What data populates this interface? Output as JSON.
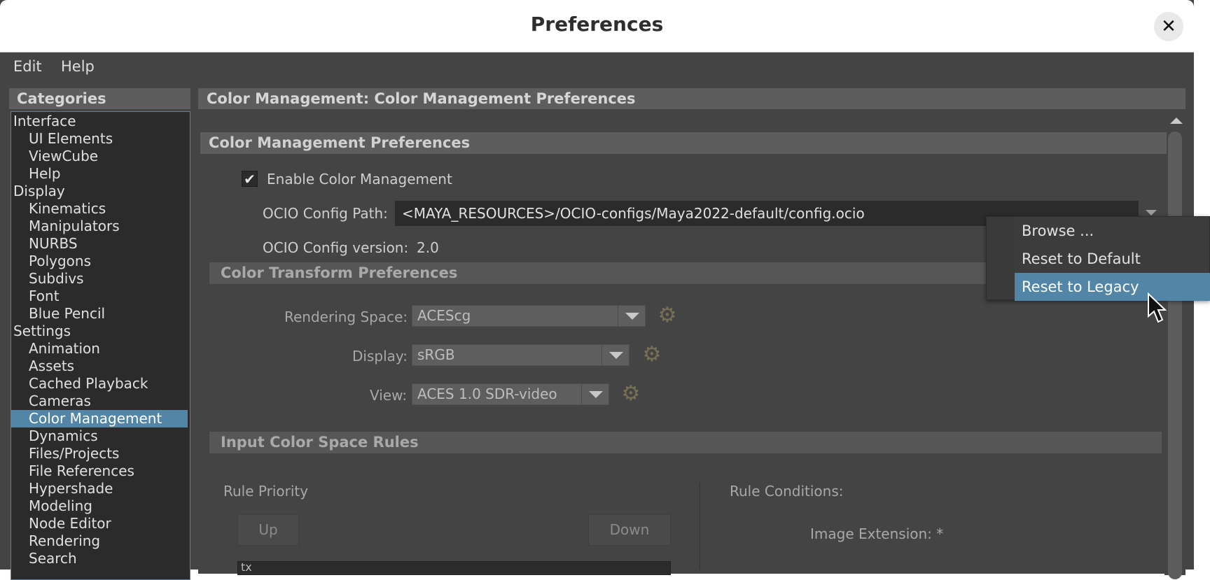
{
  "window": {
    "title": "Preferences",
    "close_glyph": "✕"
  },
  "menubar": {
    "items": [
      "Edit",
      "Help"
    ]
  },
  "categories": {
    "header": "Categories",
    "items": [
      {
        "label": "Interface",
        "indent": 0
      },
      {
        "label": "UI Elements",
        "indent": 1
      },
      {
        "label": "ViewCube",
        "indent": 1
      },
      {
        "label": "Help",
        "indent": 1
      },
      {
        "label": "Display",
        "indent": 0
      },
      {
        "label": "Kinematics",
        "indent": 1
      },
      {
        "label": "Manipulators",
        "indent": 1
      },
      {
        "label": "NURBS",
        "indent": 1
      },
      {
        "label": "Polygons",
        "indent": 1
      },
      {
        "label": "Subdivs",
        "indent": 1
      },
      {
        "label": "Font",
        "indent": 1
      },
      {
        "label": "Blue Pencil",
        "indent": 1
      },
      {
        "label": "Settings",
        "indent": 0
      },
      {
        "label": "Animation",
        "indent": 1
      },
      {
        "label": "Assets",
        "indent": 1
      },
      {
        "label": "Cached Playback",
        "indent": 1
      },
      {
        "label": "Cameras",
        "indent": 1
      },
      {
        "label": "Color Management",
        "indent": 1
      },
      {
        "label": "Dynamics",
        "indent": 1
      },
      {
        "label": "Files/Projects",
        "indent": 1
      },
      {
        "label": "File References",
        "indent": 1
      },
      {
        "label": "Hypershade",
        "indent": 1
      },
      {
        "label": "Modeling",
        "indent": 1
      },
      {
        "label": "Node Editor",
        "indent": 1
      },
      {
        "label": "Rendering",
        "indent": 1
      },
      {
        "label": "Search",
        "indent": 1
      }
    ],
    "selected": "Color Management"
  },
  "main": {
    "header": "Color Management: Color Management Preferences",
    "section_cm": "Color Management Preferences",
    "enable_label": "Enable Color Management",
    "enable_checked": true,
    "ocio_path_label": "OCIO Config Path:",
    "ocio_path_value": "<MAYA_RESOURCES>/OCIO-configs/Maya2022-default/config.ocio",
    "ocio_version_label": "OCIO Config version:",
    "ocio_version_value": "2.0",
    "section_ct": "Color Transform Preferences",
    "rendering_space_label": "Rendering Space:",
    "rendering_space_value": "ACEScg",
    "display_label": "Display:",
    "display_value": "sRGB",
    "view_label": "View:",
    "view_value": "ACES 1.0 SDR-video",
    "section_ic": "Input Color Space Rules",
    "rule_priority_label": "Rule Priority",
    "up_label": "Up",
    "down_label": "Down",
    "rule_conditions_label": "Rule Conditions:",
    "image_extension_label": "Image Extension: *",
    "rule_list_first": "tx"
  },
  "dropdown": {
    "items": [
      "Browse ...",
      "Reset to Default",
      "Reset to Legacy"
    ],
    "highlighted": "Reset to Legacy"
  },
  "icons": {
    "gear": "⚙",
    "check": "✔"
  },
  "colors": {
    "accent": "#5285a6",
    "panel_bg": "#444444",
    "field_bg": "#2b2b2b",
    "header_bg": "#5d5d5d"
  }
}
